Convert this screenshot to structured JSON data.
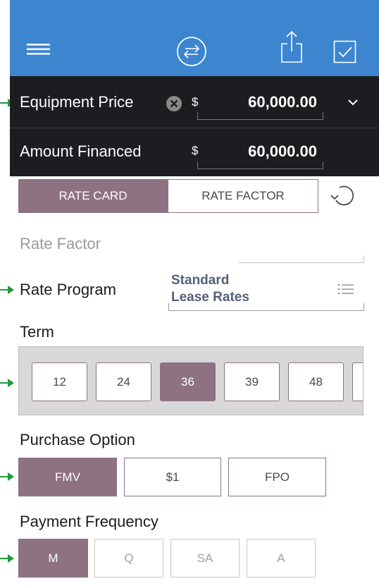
{
  "colors": {
    "header": "#3d86cf",
    "dark": "#1b1d21",
    "accent": "#8e7282",
    "marker": "#1f9a3c",
    "disabled": "#c9c9c9"
  },
  "header": {
    "icons": [
      "hamburger-menu-icon",
      "swap-circle-icon",
      "share-icon",
      "checkbox-icon"
    ]
  },
  "equipment_price": {
    "label": "Equipment Price",
    "currency": "$",
    "value": "60,000.00"
  },
  "amount_financed": {
    "label": "Amount Financed",
    "currency": "$",
    "value": "60,000.00"
  },
  "rate_mode": {
    "tabs": [
      "RATE CARD",
      "RATE FACTOR"
    ],
    "selected": "RATE CARD"
  },
  "rate_factor": {
    "label": "Rate Factor"
  },
  "rate_program": {
    "label": "Rate Program",
    "value_line1": "Standard",
    "value_line2": "Lease Rates"
  },
  "term": {
    "label": "Term",
    "options": [
      "12",
      "24",
      "36",
      "39",
      "48"
    ],
    "selected": "36"
  },
  "purchase_option": {
    "label": "Purchase Option",
    "options": [
      "FMV",
      "$1",
      "FPO"
    ],
    "selected": "FMV"
  },
  "payment_frequency": {
    "label": "Payment Frequency",
    "options": [
      "M",
      "Q",
      "SA",
      "A"
    ],
    "selected": "M"
  }
}
